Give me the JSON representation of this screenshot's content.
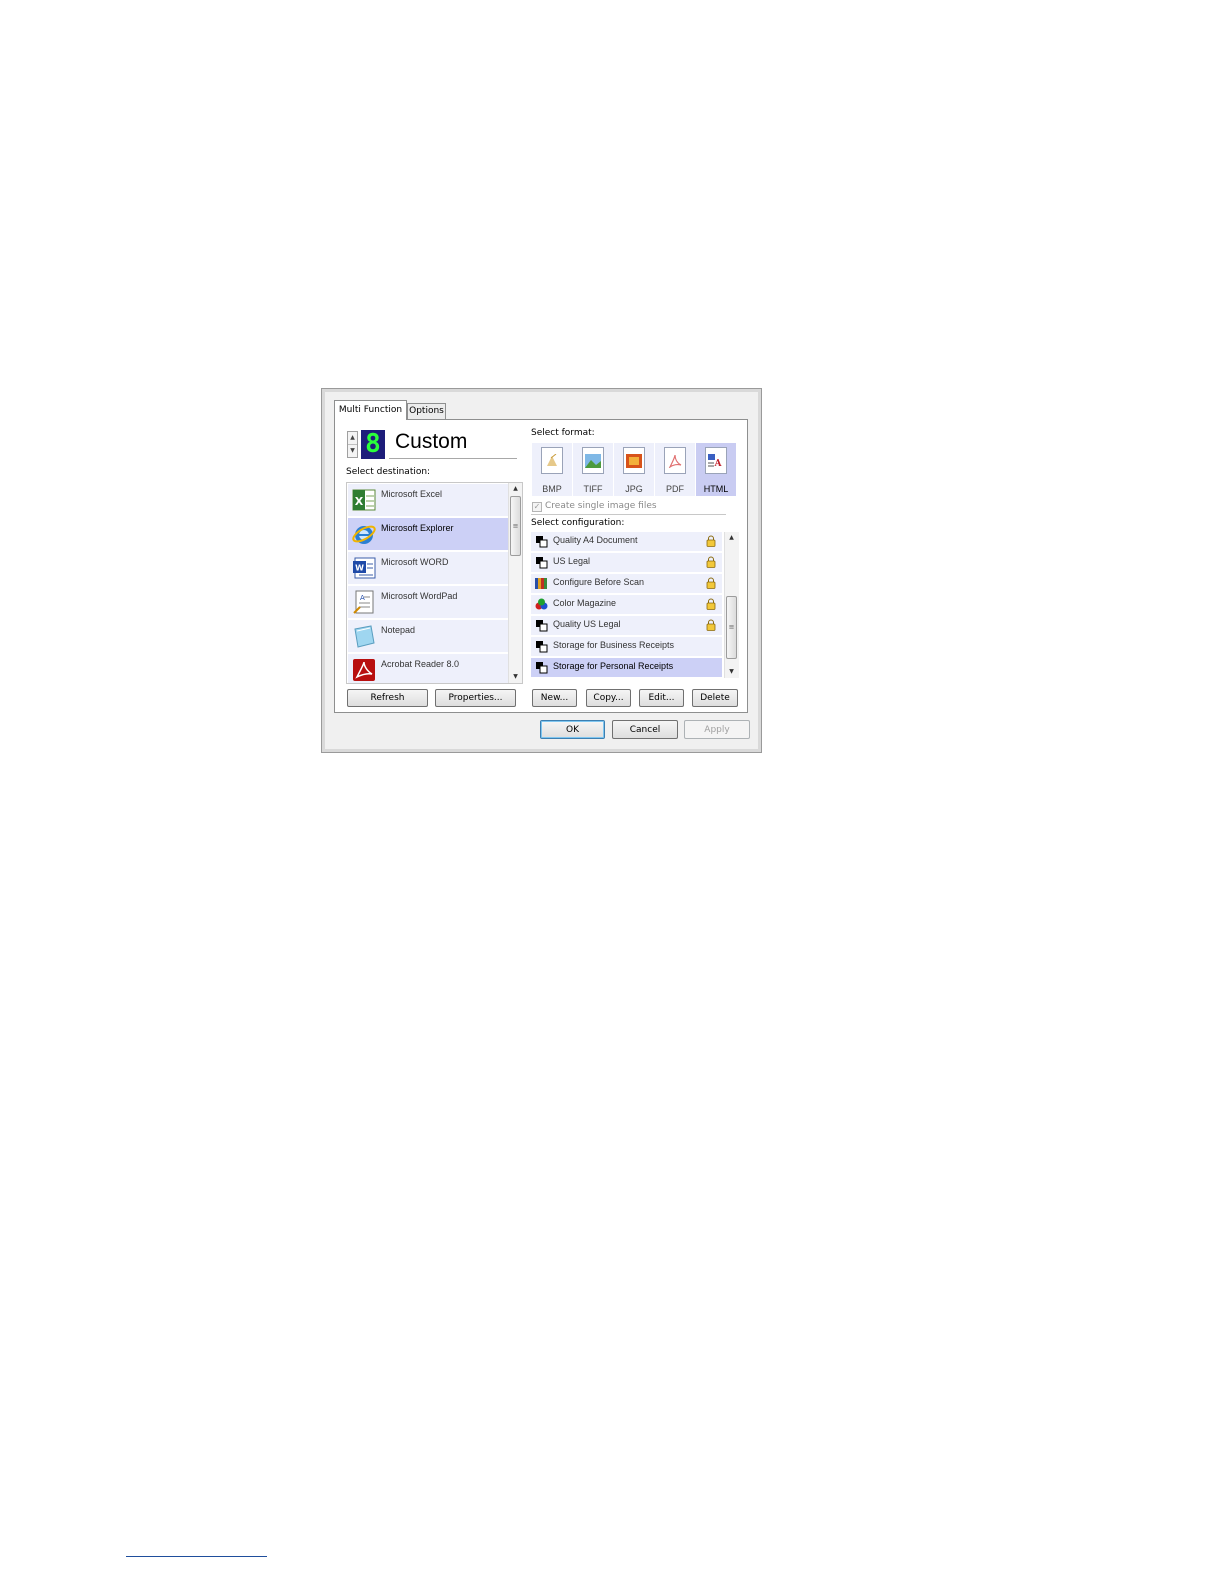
{
  "tabs": [
    "Multi Function",
    "Options"
  ],
  "header": {
    "counter_digit": "8",
    "title": "Custom"
  },
  "destination": {
    "label": "Select destination:",
    "items": [
      {
        "label": "Microsoft Excel",
        "icon": "excel-icon",
        "selected": false
      },
      {
        "label": "Microsoft Explorer",
        "icon": "internet-explorer-icon",
        "selected": true
      },
      {
        "label": "Microsoft WORD",
        "icon": "word-icon",
        "selected": false
      },
      {
        "label": "Microsoft WordPad",
        "icon": "wordpad-icon",
        "selected": false
      },
      {
        "label": "Notepad",
        "icon": "notepad-icon",
        "selected": false
      },
      {
        "label": "Acrobat Reader 8.0",
        "icon": "acrobat-icon",
        "selected": false
      }
    ],
    "buttons": {
      "refresh": "Refresh",
      "properties": "Properties..."
    }
  },
  "format": {
    "label": "Select format:",
    "options": [
      {
        "label": "BMP",
        "selected": false
      },
      {
        "label": "TIFF",
        "selected": false
      },
      {
        "label": "JPG",
        "selected": false
      },
      {
        "label": "PDF",
        "selected": false
      },
      {
        "label": "HTML",
        "selected": true
      }
    ],
    "single_image_checkbox": {
      "label": "Create single image files",
      "checked": true,
      "disabled": true
    }
  },
  "configuration": {
    "label": "Select configuration:",
    "items": [
      {
        "label": "Quality A4 Document",
        "locked": true,
        "selected": false
      },
      {
        "label": "US Legal",
        "locked": true,
        "selected": false
      },
      {
        "label": "Configure Before Scan",
        "locked": true,
        "selected": false
      },
      {
        "label": "Color Magazine",
        "locked": true,
        "selected": false
      },
      {
        "label": "Quality US Legal",
        "locked": true,
        "selected": false
      },
      {
        "label": "Storage for Business Receipts",
        "locked": false,
        "selected": false
      },
      {
        "label": "Storage for Personal Receipts",
        "locked": false,
        "selected": true
      }
    ],
    "buttons": {
      "new": "New...",
      "copy": "Copy...",
      "edit": "Edit...",
      "delete": "Delete"
    }
  },
  "dialog_buttons": {
    "ok": "OK",
    "cancel": "Cancel",
    "apply": "Apply"
  },
  "colors": {
    "item_bg": "#eef0fb",
    "item_selected_bg": "#ccd0f6",
    "led_green": "#2aff3a",
    "led_bg": "#1d1d7a"
  }
}
